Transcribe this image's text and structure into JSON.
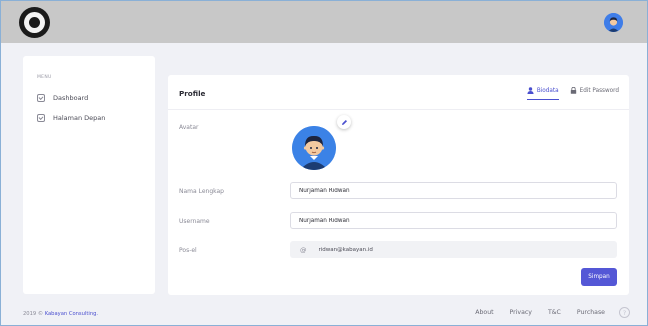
{
  "sidebar": {
    "menu_title": "MENU",
    "items": [
      {
        "label": "Dashboard",
        "icon": "check-square-icon"
      },
      {
        "label": "Halaman Depan",
        "icon": "check-square-icon"
      }
    ]
  },
  "profile": {
    "title": "Profile",
    "tabs": [
      {
        "label": "Biodata",
        "icon": "user-icon",
        "active": true
      },
      {
        "label": "Edit Password",
        "icon": "lock-icon",
        "active": false
      }
    ],
    "avatar_label": "Avatar",
    "fullname_label": "Nama Lengkap",
    "fullname_value": "Nurjaman Ridwan",
    "username_label": "Username",
    "username_value": "Nurjaman Ridwan",
    "email_label": "Pos-el",
    "email_value": "ridwan@kabayan.id",
    "save_label": "Simpan"
  },
  "footer": {
    "copyright_prefix": "2019 © ",
    "brand": "Kabayan Consulting.",
    "links": [
      "About",
      "Privacy",
      "T&C",
      "Purchase"
    ],
    "help_symbol": "?"
  },
  "colors": {
    "accent": "#5457d6",
    "topbar": "#c8c8c8",
    "background": "#f0f1f6",
    "avatar_blue": "#3b82e6"
  }
}
